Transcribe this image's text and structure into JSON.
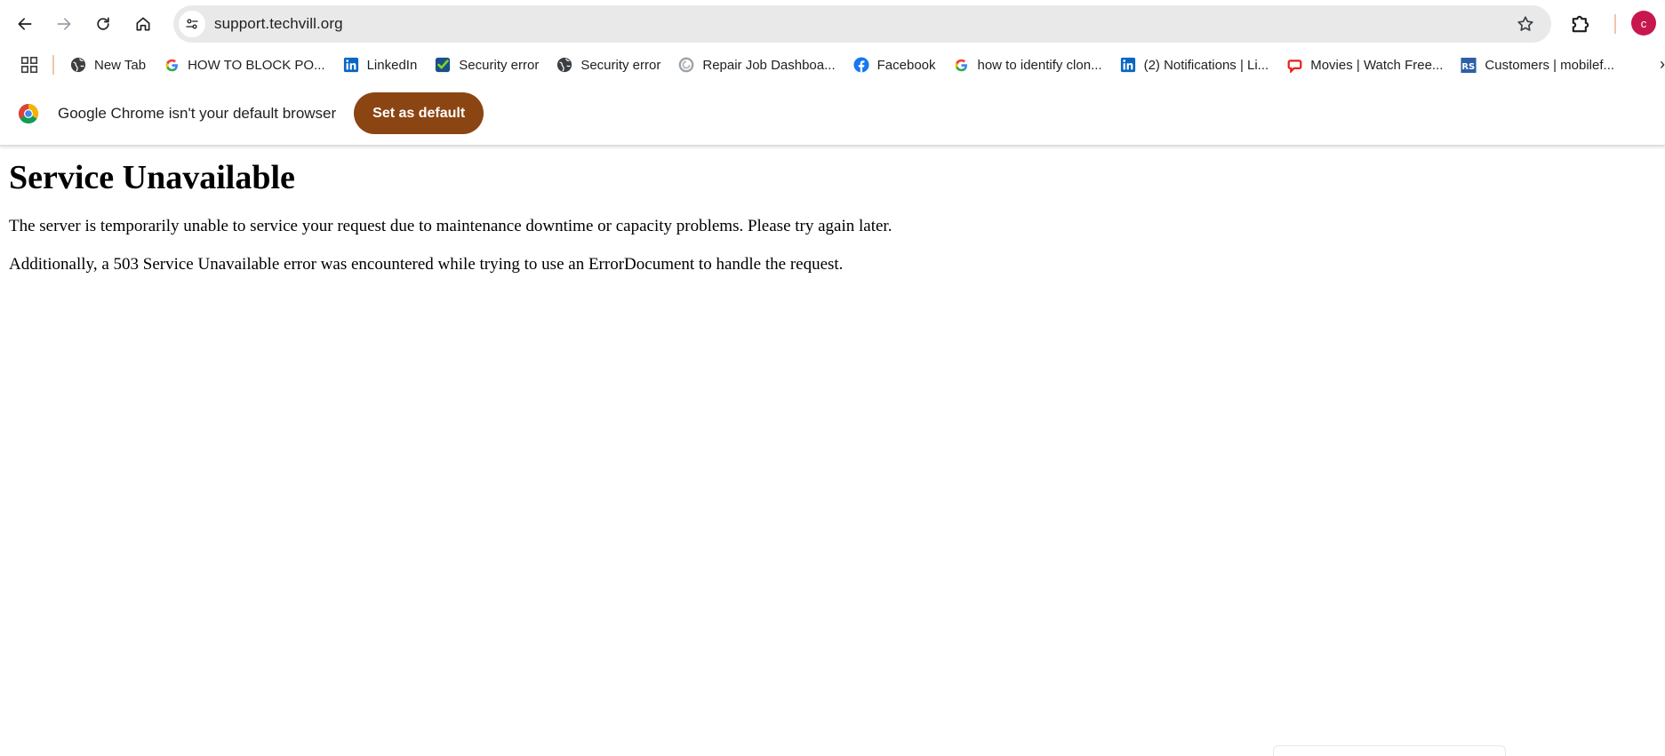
{
  "browser": {
    "url": "support.techvill.org",
    "profile_initial": "c",
    "colors": {
      "omnibox_bg": "#e9e9e9",
      "accent_button": "#8b4513",
      "avatar": "#c8174e"
    }
  },
  "bookmarks": [
    {
      "label": "New Tab",
      "icon": "globe-icon"
    },
    {
      "label": "HOW TO BLOCK PO...",
      "icon": "google-icon"
    },
    {
      "label": "LinkedIn",
      "icon": "linkedin-icon"
    },
    {
      "label": "Security error",
      "icon": "check-shield-icon"
    },
    {
      "label": "Security error",
      "icon": "globe-icon"
    },
    {
      "label": "Repair Job Dashboa...",
      "icon": "generic-site-icon"
    },
    {
      "label": "Facebook",
      "icon": "facebook-icon"
    },
    {
      "label": "how to identify clon...",
      "icon": "google-icon"
    },
    {
      "label": "(2) Notifications | Li...",
      "icon": "linkedin-icon"
    },
    {
      "label": "Movies | Watch Free...",
      "icon": "movies-icon"
    },
    {
      "label": "Customers | mobilef...",
      "icon": "rs-icon"
    }
  ],
  "infobar": {
    "message": "Google Chrome isn't your default browser",
    "button_label": "Set as default"
  },
  "page": {
    "title": "Service Unavailable",
    "paragraph1": "The server is temporarily unable to service your request due to maintenance downtime or capacity problems. Please try again later.",
    "paragraph2": "Additionally, a 503 Service Unavailable error was encountered while trying to use an ErrorDocument to handle the request."
  }
}
